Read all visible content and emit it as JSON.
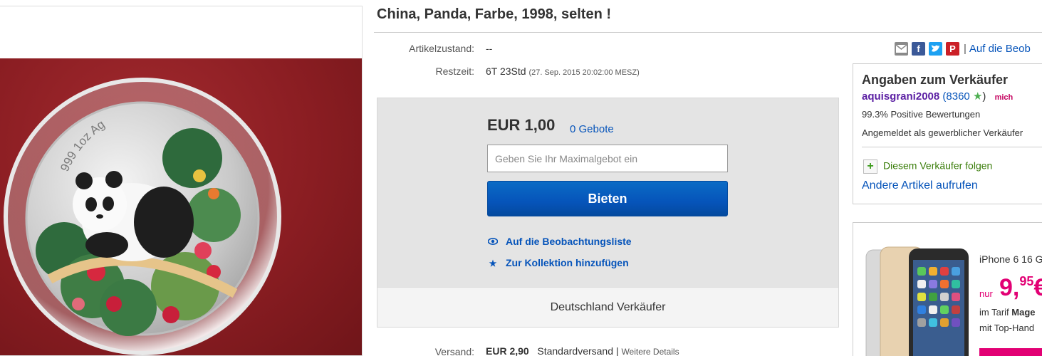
{
  "listing": {
    "title": "China, Panda, Farbe, 1998, selten !",
    "condition_label": "Artikelzustand:",
    "condition_value": "--",
    "time_label": "Restzeit:",
    "time_value": "6T 23Std",
    "time_detail": "(27. Sep. 2015   20:02:00 MESZ)"
  },
  "image": {
    "coin_text": "999 1oz Ag"
  },
  "bid": {
    "price": "EUR 1,00",
    "bids_link": "0 Gebote",
    "max_bid_placeholder": "Geben Sie Ihr Maximalgebot ein",
    "bid_button": "Bieten",
    "watch_link": "Auf die Beobachtungsliste",
    "collection_link": "Zur Kollektion hinzufügen",
    "footer": "Deutschland Verkäufer"
  },
  "shipping": {
    "label": "Versand:",
    "price": "EUR 2,90",
    "method": "Standardversand",
    "separator": "|",
    "details_link": "Weitere Details"
  },
  "share": {
    "separator": "|",
    "watch_link": "Auf die Beob"
  },
  "seller": {
    "heading": "Angaben zum Verkäufer",
    "username": "aquisgrani2008",
    "feedback_open": "(",
    "feedback_score": "8360",
    "feedback_close": ")",
    "me_badge": "mich",
    "positive": "99.3% Positive Bewertungen",
    "business": "Angemeldet als gewerblicher Verkäufer",
    "follow": "Diesem Verkäufer folgen",
    "other_items": "Andere Artikel aufrufen"
  },
  "ad": {
    "product": "iPhone 6 16 G",
    "price_prefix": "nur",
    "price_main": "9,",
    "price_cents": "95",
    "price_suffix": "€",
    "tariff_prefix": "im Tarif",
    "tariff_name": "Mage",
    "tariff_line2": "mit Top-Hand"
  },
  "colors": {
    "link_blue": "#0654ba",
    "button_blue": "#0654ba",
    "seller_purple": "#5b1fa3",
    "magenta": "#e20074",
    "follow_green": "#3a7d0a"
  },
  "icons": {
    "share": [
      "email-icon",
      "facebook-icon",
      "twitter-icon",
      "pinterest-icon"
    ],
    "watch": "eye-icon",
    "collection": "star-icon",
    "feedback_star": "star-icon",
    "follow": "plus-icon"
  }
}
